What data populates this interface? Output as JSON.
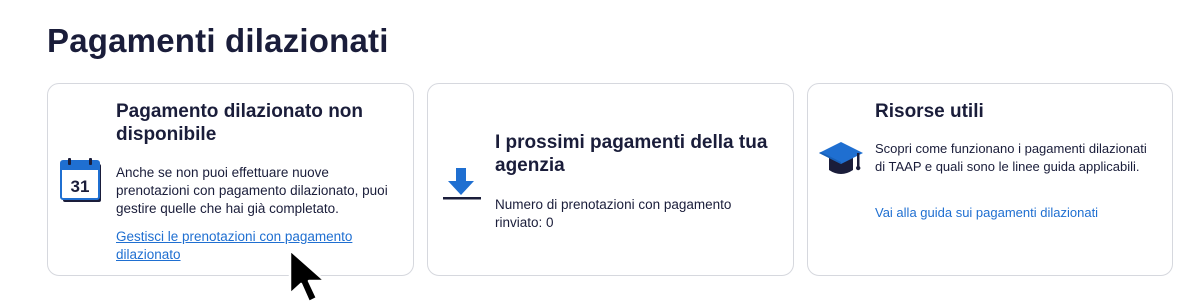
{
  "page": {
    "title": "Pagamenti dilazionati"
  },
  "cards": [
    {
      "title": "Pagamento dilazionato non disponibile",
      "icon": "calendar-icon",
      "calendar_day": "31",
      "text": "Anche se non puoi effettuare nuove prenotazioni con pagamento dilazionato, puoi gestire quelle che hai già completato.",
      "link": "Gestisci le prenotazioni con pagamento dilazionato"
    },
    {
      "title": "I prossimi pagamenti della tua agenzia",
      "icon": "download-icon",
      "text": "Numero di prenotazioni con pagamento rinviato: 0"
    },
    {
      "title": "Risorse utili",
      "icon": "graduation-cap-icon",
      "text": "Scopri come funzionano i pagamenti dilazionati di TAAP e quali sono le linee guida applicabili.",
      "link": "Vai alla guida sui pagamenti dilazionati"
    }
  ],
  "colors": {
    "primary_text": "#1a1d3a",
    "link": "#1f6fd1",
    "icon_blue": "#1f6fd1",
    "card_border": "#d6d8de"
  }
}
